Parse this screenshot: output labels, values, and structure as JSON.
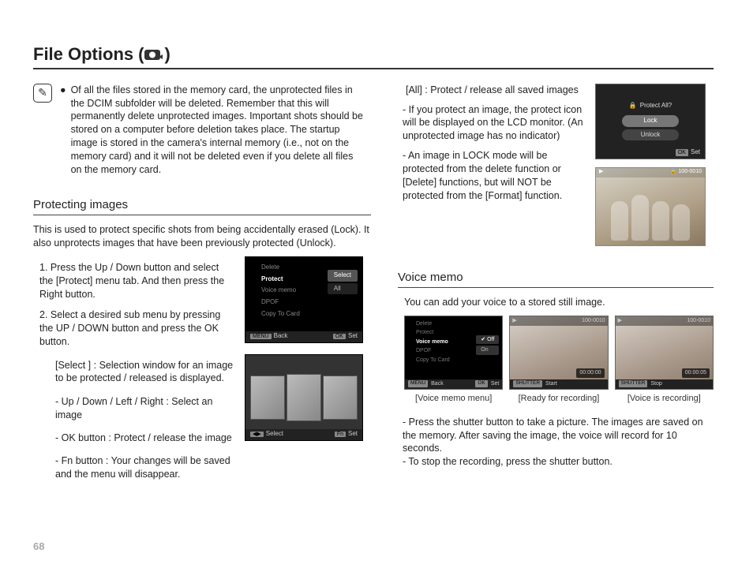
{
  "page": {
    "title": "File Options",
    "title_paren_open": " (",
    "title_paren_close": " )",
    "number": "68"
  },
  "icons": {
    "camera": "▣",
    "pencil": "✎",
    "lock": "🔒",
    "play": "▶",
    "check": "✔"
  },
  "note": {
    "bullet": "●",
    "text": "Of all the files stored in the memory card, the unprotected files in the DCIM subfolder will be deleted. Remember that this will permanently delete unprotected images. Important shots should be stored on a computer before deletion takes place. The startup image is stored in the camera's internal memory (i.e., not on the memory card) and it will not be deleted even if you delete all files on the memory card."
  },
  "left": {
    "heading": "Protecting images",
    "intro": "This is used to protect specific shots from being accidentally erased (Lock). It also unprotects images that have been previously protected (Unlock).",
    "step1": "1. Press the Up / Down button and select the [Protect] menu tab. And then press the Right button.",
    "step2": "2. Select a desired sub menu by pressing the UP / DOWN button and press the OK button.",
    "sub_select_label": "[Select ] : Selection window for an image to be protected / released is displayed.",
    "sub_udlr": "- Up / Down / Left / Right : Select an image",
    "sub_ok": "- OK button : Protect / release the image",
    "sub_fn": "- Fn button : Your changes will be saved and the menu will disappear."
  },
  "menu1": {
    "items": [
      "Delete",
      "Protect",
      "Voice memo",
      "DPOF",
      "Copy To Card"
    ],
    "options": [
      "Select",
      "All"
    ],
    "foot_left_key": "MENU",
    "foot_left": "Back",
    "foot_right_key": "OK",
    "foot_right": "Set"
  },
  "thumb_screen": {
    "foot_left_key": "◀▶",
    "foot_left": "Select",
    "foot_right_key": "Fn",
    "foot_right": "Set"
  },
  "right": {
    "all_label": "[All] : Protect / release all saved images",
    "p1": "- If you protect an image, the protect icon will be displayed on the LCD monitor. (An unprotected image has no indicator)",
    "p2": "- An image in LOCK mode will be protected from the delete function or [Delete] functions, but will NOT be protected from the [Format] function.",
    "dialog": {
      "title": "Protect All?",
      "lock": "Lock",
      "unlock": "Unlock",
      "foot_key": "OK",
      "foot": "Set"
    },
    "photo": {
      "tl_icon": "▶",
      "tr": "100-0010",
      "lock": "🔒"
    }
  },
  "voice": {
    "heading": "Voice memo",
    "intro": "You can add your voice to a stored still image.",
    "menu_items": [
      "Delete",
      "Protect",
      "Voice memo",
      "DPOF",
      "Copy To Card"
    ],
    "menu_options": [
      "Off",
      "On"
    ],
    "menu_foot_left_key": "MENU",
    "menu_foot_left": "Back",
    "menu_foot_right_key": "OK",
    "menu_foot_right": "Set",
    "ready": {
      "top_right": "100-0010",
      "mid": "00:00:00",
      "bot_key": "SHUTTER",
      "bot": "Start"
    },
    "rec": {
      "top_right": "100-0010",
      "mid": "00:00:05",
      "bot_key": "SHUTTER",
      "bot": "Stop"
    },
    "captions": [
      "[Voice memo menu]",
      "[Ready for recording]",
      "[Voice is recording]"
    ],
    "b1": "- Press the shutter button to take a picture. The images are saved on the memory. After saving the image, the voice will record for 10 seconds.",
    "b2": "- To stop the recording, press the shutter button."
  }
}
